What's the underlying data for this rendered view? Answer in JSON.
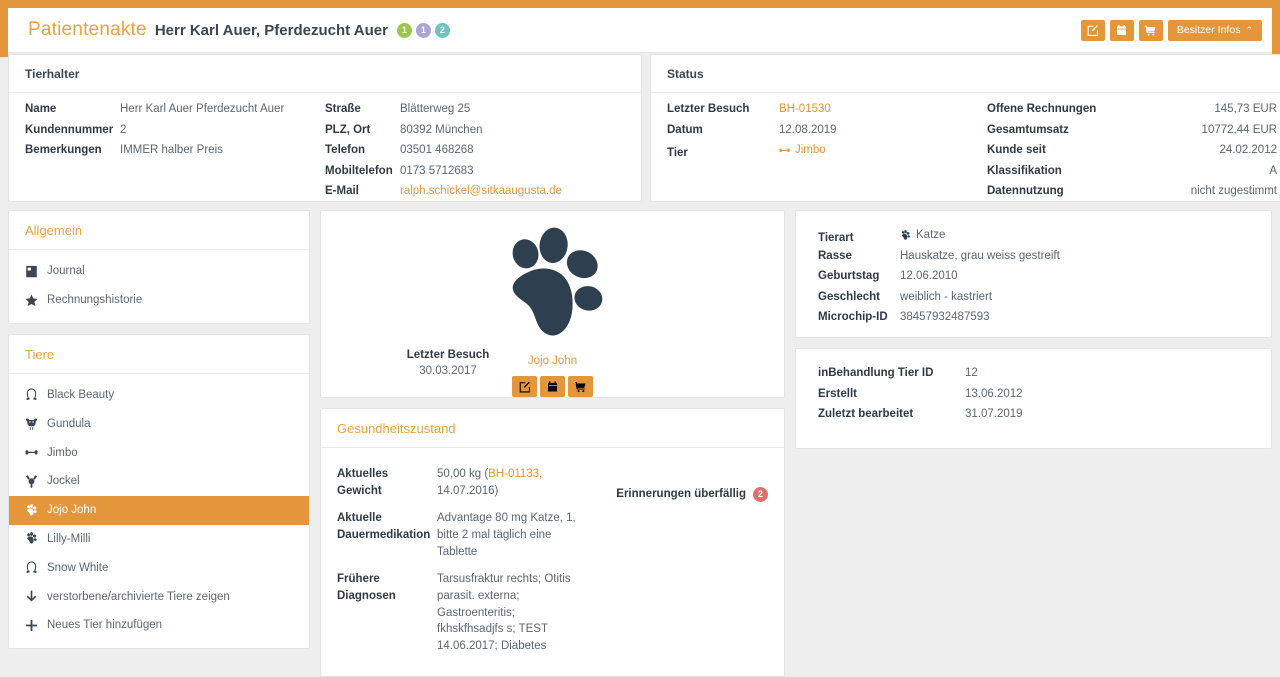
{
  "header": {
    "title": "Patientenakte",
    "subtitle": "Herr Karl Auer, Pferdezucht Auer",
    "badges": [
      {
        "value": "1",
        "color": "#9cc64b"
      },
      {
        "value": "1",
        "color": "#a9a5d4"
      },
      {
        "value": "2",
        "color": "#6cc5c0"
      }
    ],
    "actions": {
      "edit_icon": "edit-icon",
      "calendar_icon": "calendar-icon",
      "cart_icon": "cart-icon",
      "owner_info_label": "Besitzer Infos",
      "owner_info_caret": "⌃"
    }
  },
  "owner_panel": {
    "heading": "Tierhalter",
    "left": [
      {
        "key": "Name",
        "value": "Herr Karl Auer Pferdezucht Auer"
      },
      {
        "key": "Kundennummer",
        "value": "2"
      },
      {
        "key": "Bemerkungen",
        "value": "IMMER halber Preis"
      }
    ],
    "right": [
      {
        "key": "Straße",
        "value": "Blätterweg 25"
      },
      {
        "key": "PLZ, Ort",
        "value": "80392 München"
      },
      {
        "key": "Telefon",
        "value": "03501 468268"
      },
      {
        "key": "Mobiltelefon",
        "value": "0173 5712683"
      },
      {
        "key": "E-Mail",
        "value": "ralph.schickel@sitkaaugusta.de"
      }
    ]
  },
  "status_panel": {
    "heading": "Status",
    "left": [
      {
        "key": "Letzter Besuch",
        "value": "BH-01530"
      },
      {
        "key": "Datum",
        "value": "12.08.2019"
      },
      {
        "key": "Tier",
        "value": "Jimbo"
      }
    ],
    "right": [
      {
        "key": "Offene Rechnungen",
        "value": "145,73 EUR"
      },
      {
        "key": "Gesamtumsatz",
        "value": "10772,44 EUR"
      },
      {
        "key": "Kunde seit",
        "value": "24.02.2012"
      },
      {
        "key": "Klassifikation",
        "value": "A"
      },
      {
        "key": "Datennutzung",
        "value": "nicht zugestimmt"
      }
    ]
  },
  "sidebar": {
    "general": {
      "heading": "Allgemein",
      "items": [
        {
          "label": "Journal",
          "icon": "book-icon"
        },
        {
          "label": "Rechnungshistorie",
          "icon": "star-icon"
        }
      ]
    },
    "animals": {
      "heading": "Tiere",
      "items": [
        {
          "label": "Black Beauty",
          "icon": "horseshoe-icon",
          "active": false
        },
        {
          "label": "Gundula",
          "icon": "cow-icon",
          "active": false
        },
        {
          "label": "Jimbo",
          "icon": "bone-icon",
          "active": false
        },
        {
          "label": "Jockel",
          "icon": "bird-icon",
          "active": false
        },
        {
          "label": "Jojo John",
          "icon": "paw-icon",
          "active": true
        },
        {
          "label": "Lilly-Milli",
          "icon": "paw-icon",
          "active": false
        },
        {
          "label": "Snow White",
          "icon": "horseshoe-icon",
          "active": false
        },
        {
          "label": "verstorbene/archivierte Tiere zeigen",
          "icon": "arrow-down-icon",
          "active": false
        },
        {
          "label": "Neues Tier hinzufügen",
          "icon": "plus-icon",
          "active": false
        }
      ]
    }
  },
  "pet_card": {
    "avatar_icon": "paw-icon",
    "name": "Jojo John",
    "buttons": {
      "edit_icon": "edit-icon",
      "calendar_icon": "calendar-icon",
      "cart_icon": "cart-icon"
    },
    "last_visit_label": "Letzter Besuch",
    "last_visit_value": "30.03.2017"
  },
  "animal_info": [
    {
      "key": "Tierart",
      "value": "Katze",
      "icon": "paw-icon"
    },
    {
      "key": "Rasse",
      "value": "Hauskatze, grau weiss gestreift"
    },
    {
      "key": "Geburtstag",
      "value": "12.06.2010"
    },
    {
      "key": "Geschlecht",
      "value": "weiblich - kastriert"
    },
    {
      "key": "Microchip-ID",
      "value": "38457932487593"
    }
  ],
  "treatment_info": [
    {
      "key": "inBehandlung Tier ID",
      "value": "12"
    },
    {
      "key": "Erstellt",
      "value": "13.06.2012"
    },
    {
      "key": "Zuletzt bearbeitet",
      "value": "31.07.2019"
    }
  ],
  "health": {
    "heading": "Gesundheitszustand",
    "weight_label": "Aktuelles Gewicht",
    "weight_value_pre": "50,00 kg (",
    "weight_link": "BH-01133",
    "weight_value_post": ", 14.07.2016)",
    "medication_label": "Aktuelle Dauermedikation",
    "medication_value": "Advantage 80 mg Katze, 1, bitte 2 mal täglich eine Tablette",
    "diagnoses_label": "Frühere Diagnosen",
    "diagnoses_value": "Tarsusfraktur rechts; Otitis parasit. externa; Gastroenteritis; fkhskfhsadjfs s; TEST 14.06.2017; Diabetes",
    "reminders_label": "Erinnerungen überfällig",
    "reminders_count": "2",
    "reminders_color": "#e2706a"
  },
  "theme": {
    "accent": "#e4963b",
    "accent_light": "#e8a33d",
    "text_dark": "#2f3a46",
    "text_muted": "#5b6672",
    "page_bg": "#eeeeee"
  }
}
